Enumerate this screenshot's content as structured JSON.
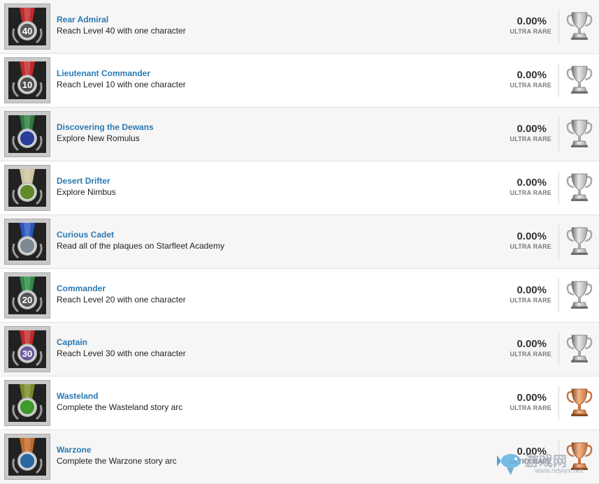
{
  "achievements": [
    {
      "title": "Rear Admiral",
      "desc": "Reach Level 40 with one character",
      "percent": "0.00%",
      "rarity": "ULTRA RARE",
      "trophy": "silver",
      "medal_icon": "rear-admiral-medal-icon",
      "medal_text": "40",
      "ribbon": "#c0282a",
      "disc": "#5a5a5a"
    },
    {
      "title": "Lieutenant Commander",
      "desc": "Reach Level 10 with one character",
      "percent": "0.00%",
      "rarity": "ULTRA RARE",
      "trophy": "silver",
      "medal_icon": "lieutenant-commander-medal-icon",
      "medal_text": "10",
      "ribbon": "#c0282a",
      "disc": "#4e4e4e"
    },
    {
      "title": "Discovering the Dewans",
      "desc": "Explore New Romulus",
      "percent": "0.00%",
      "rarity": "ULTRA RARE",
      "trophy": "silver",
      "medal_icon": "discovering-the-dewans-medal-icon",
      "medal_text": "",
      "ribbon": "#2f7a3f",
      "disc": "#2b3f9a"
    },
    {
      "title": "Desert Drifter",
      "desc": "Explore Nimbus",
      "percent": "0.00%",
      "rarity": "ULTRA RARE",
      "trophy": "silver",
      "medal_icon": "desert-drifter-medal-icon",
      "medal_text": "",
      "ribbon": "#cfc4a0",
      "disc": "#5f8a2a"
    },
    {
      "title": "Curious Cadet",
      "desc": "Read all of the plaques on Starfleet Academy",
      "percent": "0.00%",
      "rarity": "ULTRA RARE",
      "trophy": "silver",
      "medal_icon": "curious-cadet-medal-icon",
      "medal_text": "",
      "ribbon": "#2a55c0",
      "disc": "#7c8a96"
    },
    {
      "title": "Commander",
      "desc": "Reach Level 20 with one character",
      "percent": "0.00%",
      "rarity": "ULTRA RARE",
      "trophy": "silver",
      "medal_icon": "commander-medal-icon",
      "medal_text": "20",
      "ribbon": "#2f8a45",
      "disc": "#555555"
    },
    {
      "title": "Captain",
      "desc": "Reach Level 30 with one character",
      "percent": "0.00%",
      "rarity": "ULTRA RARE",
      "trophy": "silver",
      "medal_icon": "captain-medal-icon",
      "medal_text": "30",
      "ribbon": "#c0282a",
      "disc": "#6b5a9a"
    },
    {
      "title": "Wasteland",
      "desc": "Complete the Wasteland story arc",
      "percent": "0.00%",
      "rarity": "ULTRA RARE",
      "trophy": "bronze",
      "medal_icon": "wasteland-medal-icon",
      "medal_text": "",
      "ribbon": "#7a8a2a",
      "disc": "#3f9a2a"
    },
    {
      "title": "Warzone",
      "desc": "Complete the Warzone story arc",
      "percent": "0.00%",
      "rarity": "ULTRA RARE",
      "trophy": "bronze",
      "medal_icon": "warzone-medal-icon",
      "medal_text": "",
      "ribbon": "#c06a2a",
      "disc": "#2a6aa0"
    }
  ],
  "trophy_colors": {
    "silver": {
      "light": "#e8e8e8",
      "mid": "#a8a8a8",
      "dark": "#6e6e6e"
    },
    "bronze": {
      "light": "#f2b68a",
      "mid": "#c9733f",
      "dark": "#8a4a22"
    }
  },
  "watermark": {
    "text": "游戏网",
    "url": "www.newyx.net"
  }
}
